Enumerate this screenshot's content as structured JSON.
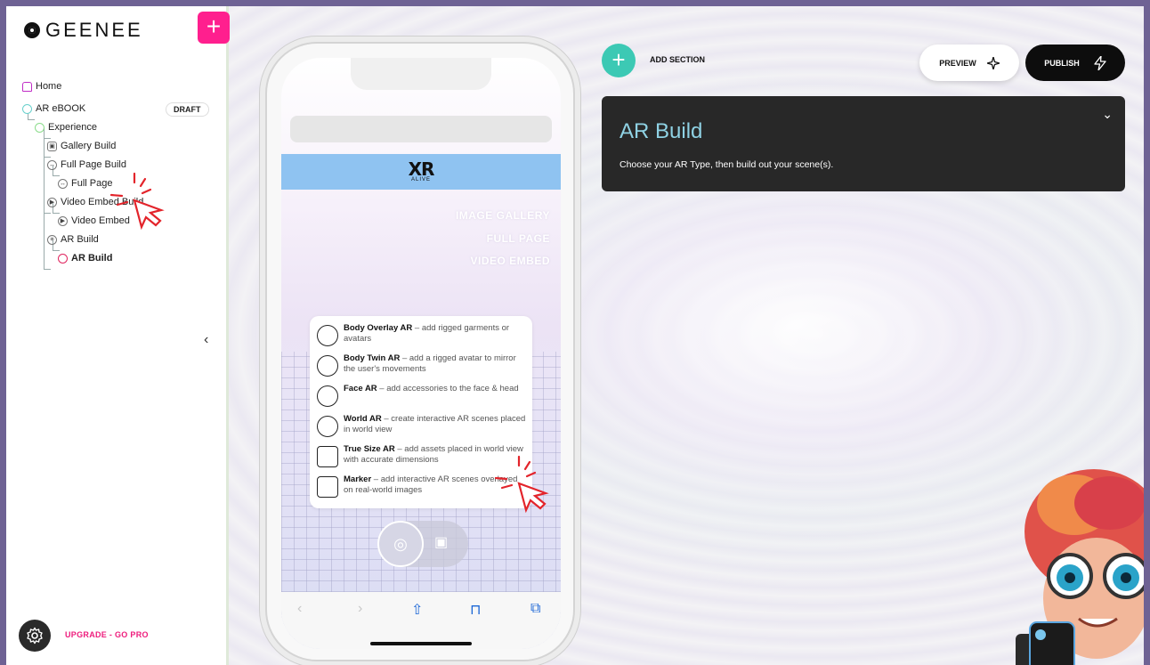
{
  "brand": {
    "name": "GEENEE"
  },
  "sidebar": {
    "tree": [
      {
        "label": "Home"
      },
      {
        "label": "AR eBOOK",
        "badge": "DRAFT"
      },
      {
        "label": "Experience"
      },
      {
        "label": "Gallery Build"
      },
      {
        "label": "Full Page Build"
      },
      {
        "label": "Full Page"
      },
      {
        "label": "Video Embed Build"
      },
      {
        "label": "Video Embed"
      },
      {
        "label": "AR Build"
      },
      {
        "label": "AR Build"
      }
    ],
    "upgrade_label": "UPGRADE - GO PRO"
  },
  "phone": {
    "banner_logo": "XR",
    "banner_sub": "ALIVE",
    "menu": [
      "IMAGE GALLERY",
      "FULL PAGE",
      "VIDEO EMBED"
    ],
    "ar_types": [
      {
        "name": "Body Overlay AR",
        "desc": " – add rigged garments or avatars",
        "icon": "body-overlay-icon"
      },
      {
        "name": "Body Twin AR",
        "desc": " – add a rigged avatar to mirror the user's movements",
        "icon": "body-twin-icon"
      },
      {
        "name": "Face AR",
        "desc": " – add accessories to the face & head",
        "icon": "face-icon"
      },
      {
        "name": "World AR",
        "desc": " – create interactive AR scenes placed in world view",
        "icon": "globe-icon"
      },
      {
        "name": "True Size AR",
        "desc": " – add assets placed in world view with accurate dimensions",
        "icon": "true-size-icon"
      },
      {
        "name": "Marker",
        "desc": " – add interactive AR scenes overlayed on real-world images",
        "icon": "marker-icon"
      }
    ]
  },
  "toolbar": {
    "add_section_label": "ADD SECTION",
    "preview_label": "PREVIEW",
    "publish_label": "PUBLISH"
  },
  "panel": {
    "title": "AR Build",
    "description": "Choose your AR Type, then build out your scene(s)."
  },
  "colors": {
    "accent_pink": "#ff1f8e",
    "accent_teal": "#3cc9b4",
    "panel_bg": "#282828",
    "panel_title": "#8fd2e4"
  }
}
